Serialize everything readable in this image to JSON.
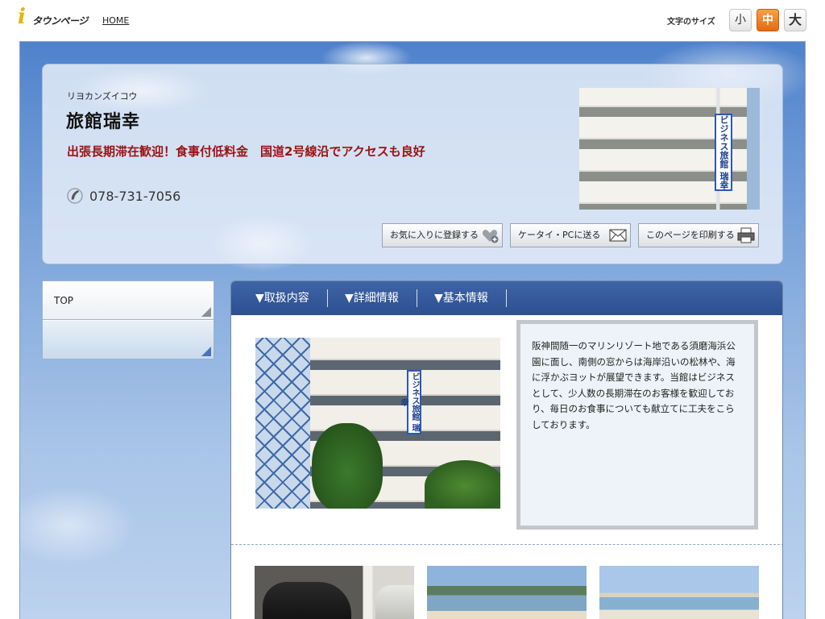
{
  "topbar": {
    "logo_text": "タウンページ",
    "home_link": "HOME",
    "font_size_label": "文字のサイズ",
    "font_sizes": [
      "小",
      "中",
      "大"
    ],
    "font_size_selected": "中"
  },
  "header": {
    "kana": "リヨカンズイコウ",
    "name": "旅館瑞幸",
    "catch_copy": "出張長期滞在歓迎！食事付低料金　国道2号線沿でアクセスも良好",
    "phone": "078-731-7056",
    "photo_sign": "ビジネス旅館 瑞幸",
    "buttons": {
      "favorite": "お気に入りに登録する",
      "send": "ケータイ・PCに送る",
      "print": "このページを印刷する"
    }
  },
  "sidenav": {
    "items": [
      {
        "label": "TOP"
      },
      {
        "label": ""
      }
    ]
  },
  "main": {
    "tabs": [
      "▼取扱内容",
      "▼詳細情報",
      "▼基本情報"
    ],
    "photo_sign": "ビジネス旅館 瑞幸",
    "description": "阪神間随一のマリンリゾート地である須磨海浜公園に面し、南側の窓からは海岸沿いの松林や、海に浮かぶヨットが展望できます。当館はビジネスとして、少人数の長期滞在のお客様を歓迎しており、毎日のお食事についても献立てに工夫をこらしております。"
  },
  "colors": {
    "accent_orange": "#e46a10",
    "tab_blue": "#2c4f90",
    "catch_red": "#9b1212"
  },
  "icons": {
    "logo": "i-logo",
    "phone": "phone-handset-icon",
    "favorite": "heart-plus-icon",
    "send": "envelope-icon",
    "print": "printer-icon"
  }
}
